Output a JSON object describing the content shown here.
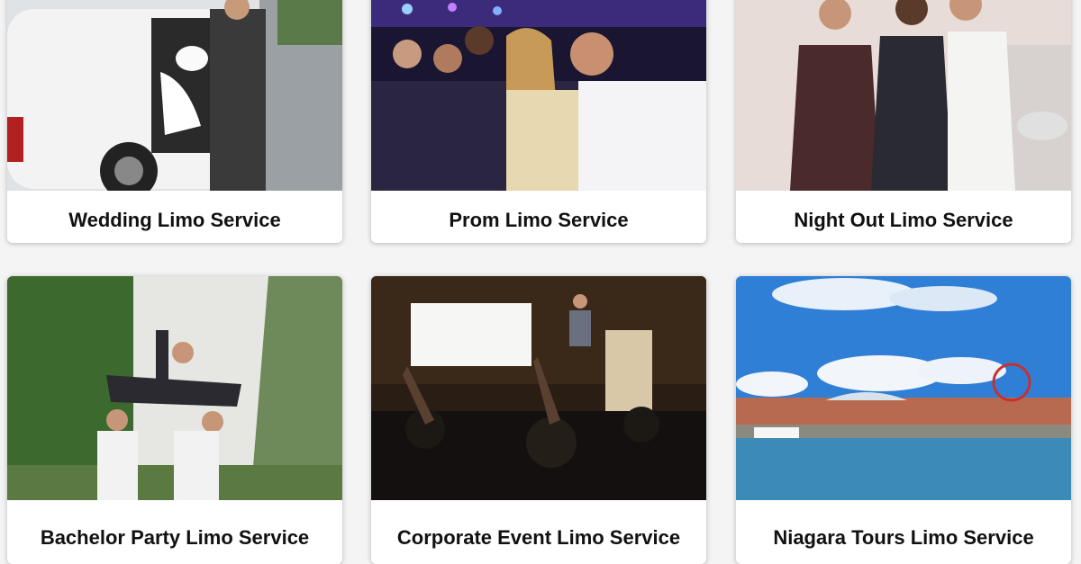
{
  "cards": [
    {
      "title": "Wedding Limo Service",
      "image": "wedding-limo-photo"
    },
    {
      "title": "Prom Limo Service",
      "image": "prom-limo-photo"
    },
    {
      "title": "Night Out Limo Service",
      "image": "night-out-limo-photo"
    },
    {
      "title": "Bachelor Party Limo Service",
      "image": "bachelor-party-photo"
    },
    {
      "title": "Corporate Event Limo Service",
      "image": "corporate-event-photo"
    },
    {
      "title": "Niagara Tours Limo Service",
      "image": "niagara-tours-photo"
    }
  ]
}
